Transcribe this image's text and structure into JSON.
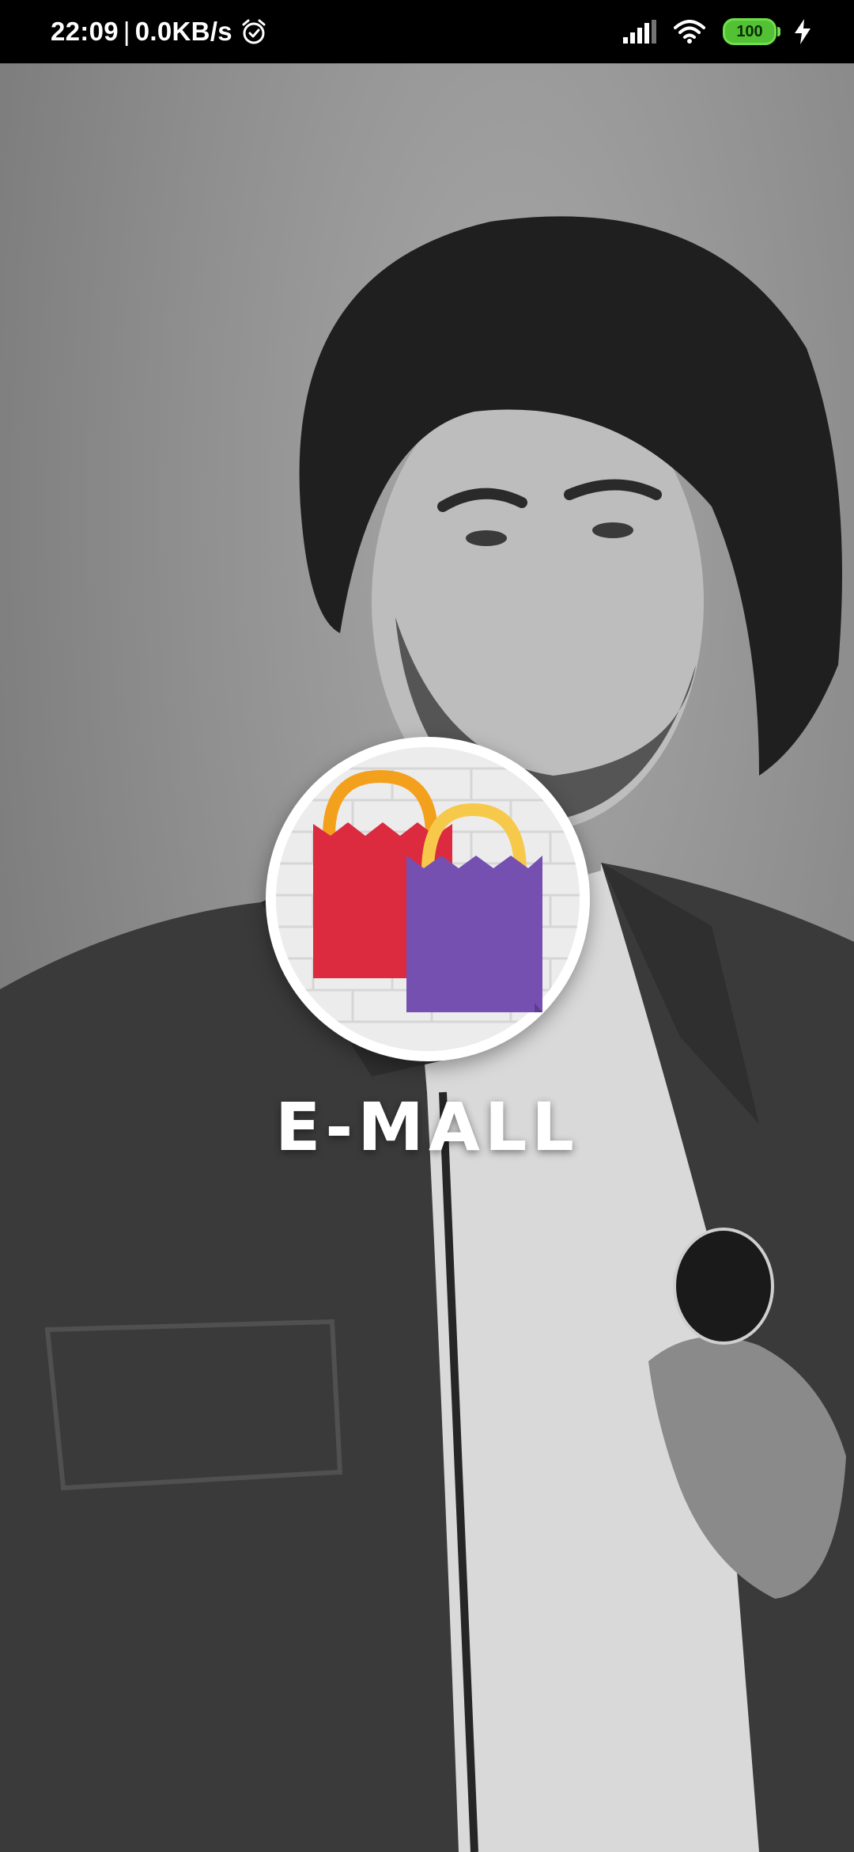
{
  "status_bar": {
    "time": "22:09",
    "separator": "|",
    "network_speed": "0.0KB/s",
    "alarm_icon": "alarm-clock-icon",
    "signal_icon": "cellular-signal-icon",
    "wifi_icon": "wifi-icon",
    "battery_level": "100",
    "charging_icon": "charging-bolt-icon",
    "battery_color": "#52c234"
  },
  "splash": {
    "app_name": "E-MALL",
    "logo_icon": "shopping-bags-icon",
    "logo_colors": {
      "red_bag": "#dc2b3f",
      "purple_bag": "#7650b0",
      "handle_orange": "#f3a01c",
      "handle_yellow": "#f7c94a"
    },
    "background": "grayscale-portrait-photo"
  }
}
